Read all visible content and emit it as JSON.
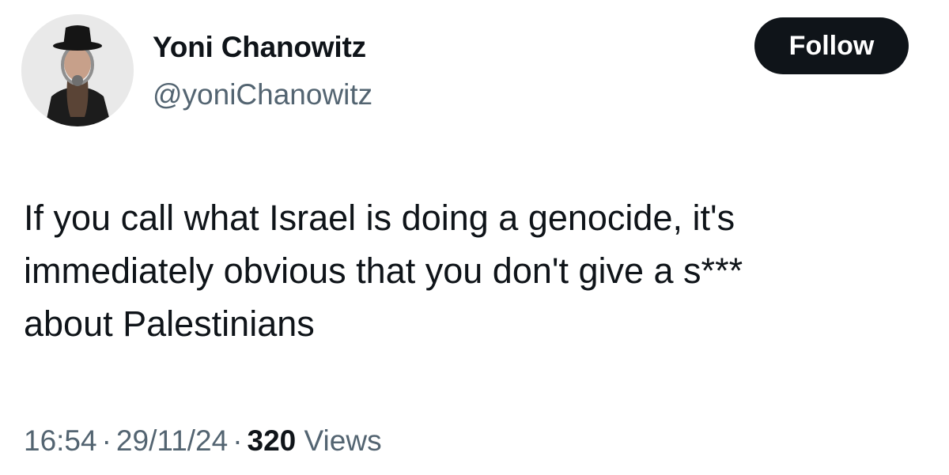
{
  "author": {
    "display_name": "Yoni Chanowitz",
    "handle": "@yoniChanowitz",
    "avatar_icon": "profile-photo-gas-mask"
  },
  "follow_button": {
    "label": "Follow"
  },
  "tweet": {
    "lines": [
      "If you call what Israel is doing a genocide, it's",
      "immediately obvious that you don't give a s***",
      "about Palestinians"
    ]
  },
  "meta": {
    "time": "16:54",
    "separator": "·",
    "date": "29/11/24",
    "views_count": "320",
    "views_label": "Views"
  },
  "colors": {
    "text_primary": "#0f1419",
    "text_secondary": "#536471",
    "button_bg": "#0f1419",
    "button_text": "#ffffff"
  }
}
